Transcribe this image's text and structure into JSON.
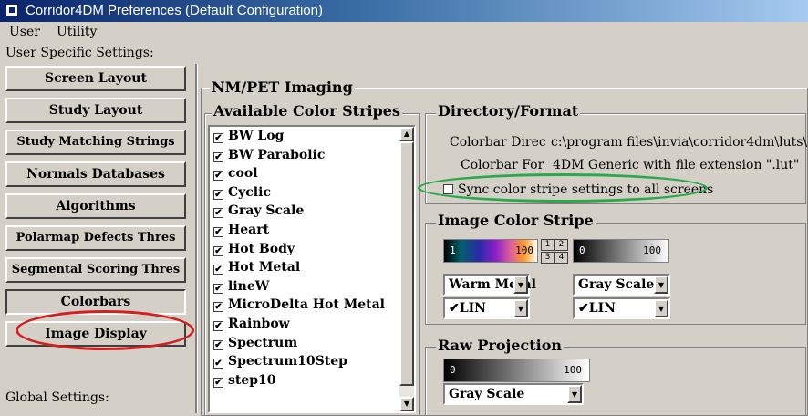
{
  "window": {
    "title": "Corridor4DM Preferences (Default Configuration)"
  },
  "menu": {
    "items": [
      "User",
      "Utility"
    ]
  },
  "sidebar": {
    "user_heading": "User Specific Settings:",
    "buttons": [
      "Screen Layout",
      "Study Layout",
      "Study Matching Strings",
      "Normals Databases",
      "Algorithms",
      "Polarmap Defects Thres",
      "Segmental Scoring Thres",
      "Colorbars",
      "Image Display"
    ],
    "global_heading": "Global Settings:"
  },
  "main": {
    "section_title": "NM/PET Imaging",
    "color_stripes": {
      "title": "Available Color Stripes",
      "items": [
        {
          "label": "BW Log",
          "checked": true
        },
        {
          "label": "BW Parabolic",
          "checked": true
        },
        {
          "label": "cool",
          "checked": true
        },
        {
          "label": "Cyclic",
          "checked": true
        },
        {
          "label": "Gray Scale",
          "checked": true
        },
        {
          "label": "Heart",
          "checked": true
        },
        {
          "label": "Hot Body",
          "checked": true
        },
        {
          "label": "Hot Metal",
          "checked": true
        },
        {
          "label": "lineW",
          "checked": true
        },
        {
          "label": "MicroDelta Hot Metal",
          "checked": true
        },
        {
          "label": "Rainbow",
          "checked": true
        },
        {
          "label": "Spectrum",
          "checked": true
        },
        {
          "label": "Spectrum10Step",
          "checked": true
        },
        {
          "label": "step10",
          "checked": true
        }
      ]
    },
    "directory": {
      "title": "Directory/Format",
      "dir_label": "Colorbar Direc",
      "dir_value": "c:\\program files\\invia\\corridor4dm\\luts\\",
      "format_label": "Colorbar For",
      "format_value": "4DM Generic with file extension \".lut\"",
      "sync_label": "Sync color stripe settings to all screens"
    },
    "image_color_stripe": {
      "title": "Image Color Stripe",
      "bar1": {
        "min": "1",
        "max": "100"
      },
      "bar2": {
        "min": "0",
        "max": "100"
      },
      "grid": [
        "1",
        "2",
        "3",
        "4"
      ],
      "select1": "Warm Metal",
      "select2": "Gray Scale",
      "scale1": "✔LIN",
      "scale2": "✔LIN"
    },
    "raw_projection": {
      "title": "Raw Projection",
      "bar": {
        "min": "0",
        "max": "100"
      },
      "select": "Gray Scale"
    }
  },
  "colors": {
    "annotation_red": "#d21f1f",
    "annotation_green": "#2aa84a"
  }
}
